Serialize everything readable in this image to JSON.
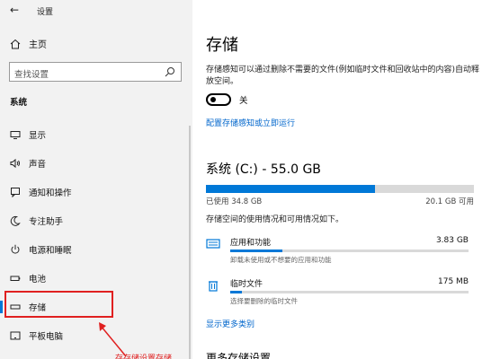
{
  "window": {
    "title": "设置"
  },
  "sidebar": {
    "home_label": "主页",
    "search_placeholder": "查找设置",
    "section_label": "系统",
    "items": [
      {
        "label": "显示",
        "icon": "display-icon"
      },
      {
        "label": "声音",
        "icon": "sound-icon"
      },
      {
        "label": "通知和操作",
        "icon": "notifications-icon"
      },
      {
        "label": "专注助手",
        "icon": "moon-icon"
      },
      {
        "label": "电源和睡眠",
        "icon": "power-icon"
      },
      {
        "label": "电池",
        "icon": "battery-icon"
      },
      {
        "label": "存储",
        "icon": "storage-icon",
        "active": true
      },
      {
        "label": "平板电脑",
        "icon": "tablet-icon"
      }
    ],
    "annotation_text": "存存储设置存储"
  },
  "main": {
    "title": "存储",
    "description": "存储感知可以通过删除不需要的文件(例如临时文件和回收站中的内容)自动释放空间。",
    "toggle_state": "关",
    "storage_sense_link": "配置存储感知或立即运行",
    "drive_title": "系统 (C:) - 55.0 GB",
    "used_label": "已使用 34.8 GB",
    "available_label": "20.1 GB 可用",
    "usage_fraction": 0.63,
    "usage_desc": "存储空间的使用情况和可用情况如下。",
    "categories": [
      {
        "name": "应用和功能",
        "size": "3.83 GB",
        "sub": "卸载未使用或不想要的应用和功能",
        "fraction": 0.22,
        "icon": "apps-icon"
      },
      {
        "name": "临时文件",
        "size": "175 MB",
        "sub": "选择要删除的临时文件",
        "fraction": 0.05,
        "icon": "trash-icon"
      }
    ],
    "show_more_link": "显示更多类别",
    "more_settings_title": "更多存储设置"
  },
  "colors": {
    "accent": "#0078d7",
    "annotation": "#e02020"
  }
}
